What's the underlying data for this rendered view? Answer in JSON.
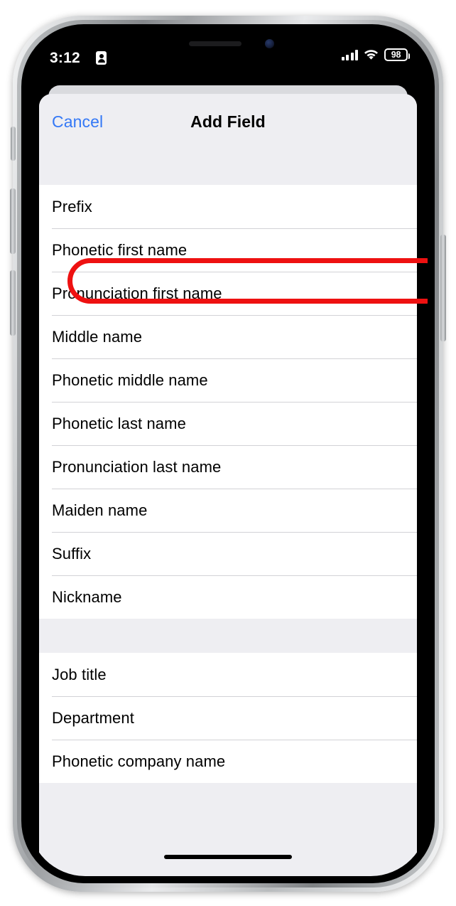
{
  "status_bar": {
    "time": "3:12",
    "contact_icon": "contact-card-icon",
    "signal_icon": "cellular-signal-icon",
    "wifi_icon": "wifi-icon",
    "battery_percent": "98"
  },
  "sheet": {
    "cancel_label": "Cancel",
    "title": "Add Field",
    "accent_color": "#3478f6",
    "groups": [
      {
        "items": [
          "Prefix",
          "Phonetic first name",
          "Pronunciation first name",
          "Middle name",
          "Phonetic middle name",
          "Phonetic last name",
          "Pronunciation last name",
          "Maiden name",
          "Suffix",
          "Nickname"
        ]
      },
      {
        "items": [
          "Job title",
          "Department",
          "Phonetic company name"
        ]
      }
    ]
  },
  "annotation": {
    "target": "Phonetic first name",
    "color": "#ee1111"
  }
}
